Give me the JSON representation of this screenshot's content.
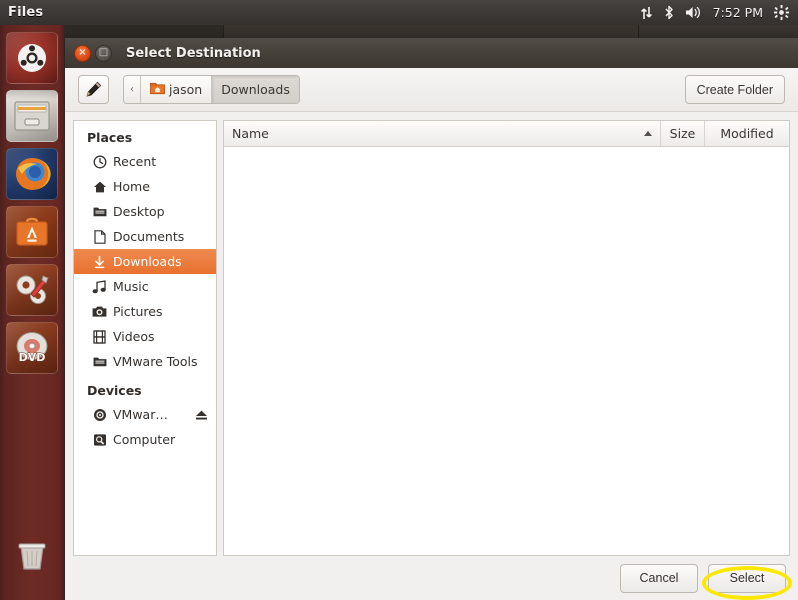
{
  "panel": {
    "app_name": "Files",
    "clock": "7:52 PM",
    "indicators": [
      {
        "name": "network-icon",
        "glyph": "⇅"
      },
      {
        "name": "bluetooth-icon",
        "glyph": "ᛦ"
      },
      {
        "name": "volume-icon",
        "glyph": "🔊"
      },
      {
        "name": "system-menu-icon",
        "glyph": "⚙"
      }
    ]
  },
  "launcher": {
    "items": [
      {
        "name": "ubuntu-dash-icon",
        "label": "Dash home"
      },
      {
        "name": "files-icon",
        "label": "Files"
      },
      {
        "name": "firefox-icon",
        "label": "Firefox Web Browser"
      },
      {
        "name": "software-center-icon",
        "label": "Ubuntu Software Center"
      },
      {
        "name": "system-settings-icon",
        "label": "System Settings"
      },
      {
        "name": "dvd-icon",
        "label": "DVD"
      }
    ],
    "trash": {
      "name": "trash-icon",
      "label": "Trash"
    }
  },
  "dialog": {
    "title": "Select Destination",
    "window_buttons": {
      "close": "×",
      "maximize": "□"
    },
    "toolbar": {
      "location_toggle_name": "pencil-icon",
      "create_folder_label": "Create Folder"
    },
    "pathbar": {
      "separator": "‹",
      "crumbs": [
        {
          "label": "jason",
          "icon": "home-folder-icon",
          "active": false
        },
        {
          "label": "Downloads",
          "icon": "",
          "active": true
        }
      ]
    },
    "sidebar": {
      "sections": [
        {
          "heading": "Places",
          "items": [
            {
              "label": "Recent",
              "icon": "clock-icon",
              "selected": false,
              "eject": false
            },
            {
              "label": "Home",
              "icon": "home-icon",
              "selected": false,
              "eject": false
            },
            {
              "label": "Desktop",
              "icon": "folder-icon",
              "selected": false,
              "eject": false
            },
            {
              "label": "Documents",
              "icon": "document-icon",
              "selected": false,
              "eject": false
            },
            {
              "label": "Downloads",
              "icon": "download-icon",
              "selected": true,
              "eject": false
            },
            {
              "label": "Music",
              "icon": "music-note-icon",
              "selected": false,
              "eject": false
            },
            {
              "label": "Pictures",
              "icon": "camera-icon",
              "selected": false,
              "eject": false
            },
            {
              "label": "Videos",
              "icon": "film-icon",
              "selected": false,
              "eject": false
            },
            {
              "label": "VMware Tools",
              "icon": "folder-icon",
              "selected": false,
              "eject": false
            }
          ]
        },
        {
          "heading": "Devices",
          "items": [
            {
              "label": "VMwar…",
              "icon": "disc-icon",
              "selected": false,
              "eject": true
            },
            {
              "label": "Computer",
              "icon": "computer-icon",
              "selected": false,
              "eject": false
            }
          ]
        }
      ]
    },
    "filelist": {
      "columns": [
        {
          "label": "Name",
          "sorted": true,
          "sort_direction": "ascending"
        },
        {
          "label": "Size",
          "sorted": false,
          "sort_direction": ""
        },
        {
          "label": "Modified",
          "sorted": false,
          "sort_direction": ""
        }
      ],
      "rows": []
    },
    "actions": {
      "cancel_label": "Cancel",
      "select_label": "Select"
    }
  },
  "annotation": {
    "name": "highlight-ellipse",
    "target": "Select",
    "color": "#ffe800"
  }
}
